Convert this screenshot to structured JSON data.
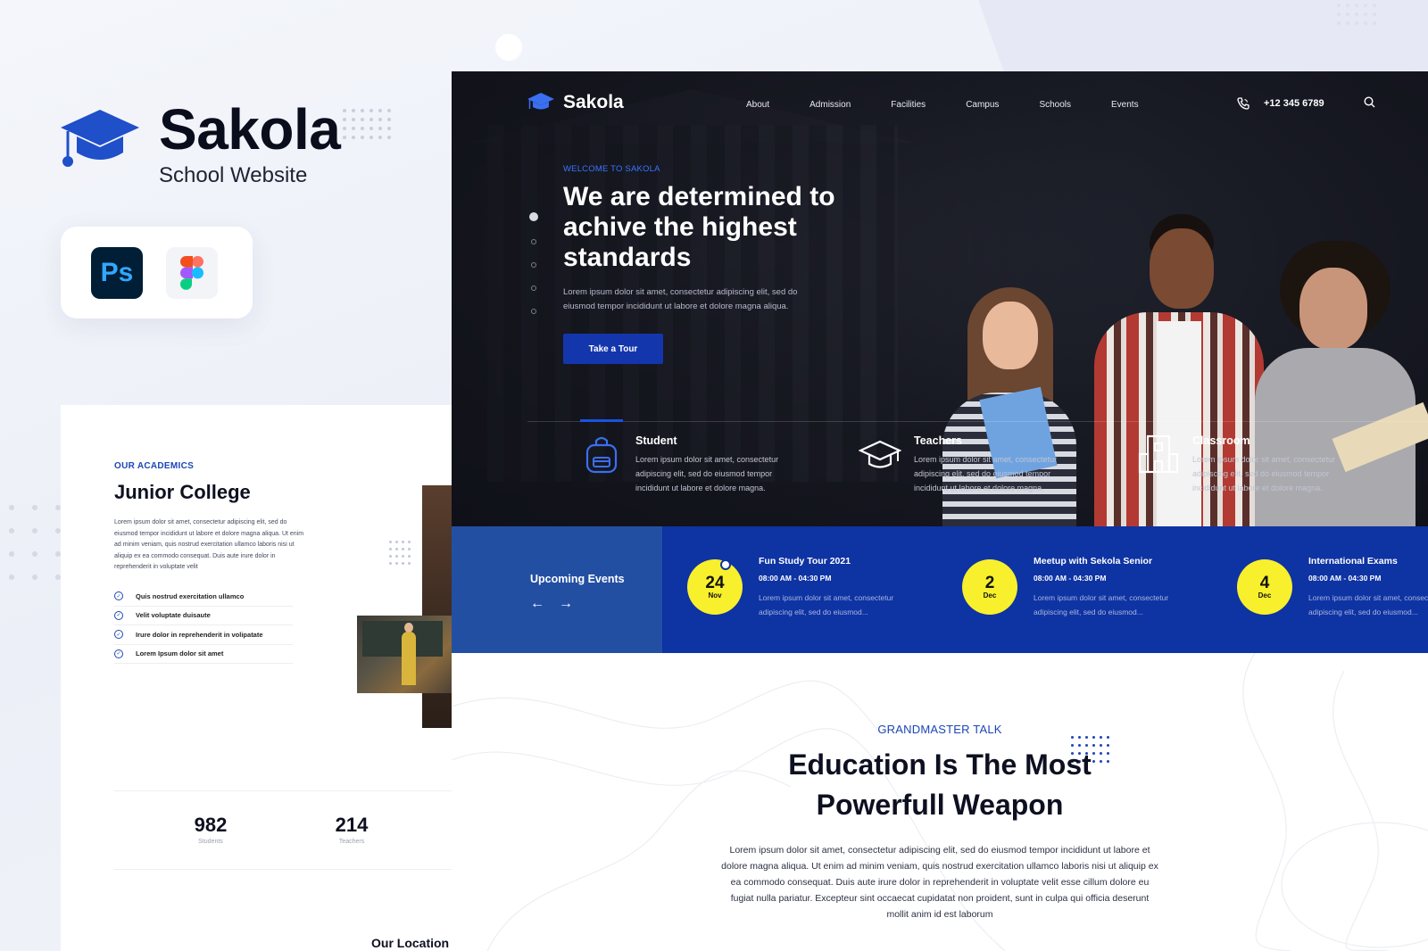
{
  "promo": {
    "brand_name": "Sakola",
    "brand_subtitle": "School Website",
    "tools": [
      "photoshop-icon",
      "figma-icon"
    ],
    "ps_label": "Ps"
  },
  "academics": {
    "eyebrow": "OUR ACADEMICS",
    "title": "Junior College",
    "body": "Lorem ipsum dolor sit amet, consectetur adipiscing elit, sed do eiusmod tempor incididunt ut labore et dolore magna aliqua. Ut enim ad minim veniam, quis nostrud exercitation ullamco laboris nisi ut aliquip ex ea commodo consequat. Duis aute irure dolor in reprehenderit in voluptate velit",
    "checklist": [
      "Quis nostrud exercitation ullamco",
      "Velit voluptate duisaute",
      "Irure dolor in reprehenderit in volipatate",
      "Lorem Ipsum dolor sit amet"
    ],
    "stats": [
      {
        "value": "982",
        "label": "Students"
      },
      {
        "value": "214",
        "label": "Teachers"
      }
    ],
    "location_heading": "Our Location"
  },
  "nav": {
    "logo_text": "Sakola",
    "menu": [
      "About",
      "Admission",
      "Facilities",
      "Campus",
      "Schools",
      "Events"
    ],
    "phone": "+12 345 6789"
  },
  "hero": {
    "eyebrow": "WELCOME TO SAKOLA",
    "title": "We are determined to achive the highest standards",
    "body": "Lorem ipsum dolor sit amet, consectetur adipiscing elit, sed do eiusmod tempor incididunt ut labore et dolore magna aliqua.",
    "cta": "Take a Tour"
  },
  "features": [
    {
      "icon": "backpack-icon",
      "title": "Student",
      "body": "Lorem ipsum dolor sit amet, consectetur adipiscing elit, sed do eiusmod tempor incididunt ut labore et dolore magna."
    },
    {
      "icon": "graduation-cap-icon",
      "title": "Teachers",
      "body": "Lorem ipsum dolor sit amet, consectetur adipiscing elit, sed do eiusmod tempor incididunt ut labore et dolore magna."
    },
    {
      "icon": "building-icon",
      "title": "Classroom",
      "body": "Lorem ipsum dolor sit amet, consectetur adipiscing elit, sed do eiusmod tempor incididunt ut labore et dolore magna."
    }
  ],
  "events": {
    "heading": "Upcoming Events",
    "prev_arrow": "←",
    "next_arrow": "→",
    "items": [
      {
        "day": "24",
        "month": "Nov",
        "title": "Fun Study Tour 2021",
        "time": "08:00 AM - 04:30 PM",
        "body": "Lorem ipsum dolor sit amet, consectetur adipiscing elit, sed do eiusmod..."
      },
      {
        "day": "2",
        "month": "Dec",
        "title": "Meetup with Sekola Senior",
        "time": "08:00 AM - 04:30 PM",
        "body": "Lorem ipsum dolor sit amet, consectetur adipiscing elit, sed do eiusmod..."
      },
      {
        "day": "4",
        "month": "Dec",
        "title": "International Exams",
        "time": "08:00 AM - 04:30 PM",
        "body": "Lorem ipsum dolor sit amet, consectetur adipiscing elit, sed do eiusmod..."
      }
    ]
  },
  "talk": {
    "eyebrow": "GRANDMASTER TALK",
    "title": "Education Is The Most Powerfull Weapon",
    "body": "Lorem ipsum dolor sit amet, consectetur adipiscing elit, sed do eiusmod tempor incididunt ut labore et dolore magna aliqua. Ut enim ad minim veniam, quis nostrud exercitation ullamco laboris nisi ut aliquip ex ea commodo consequat. Duis aute irure dolor in reprehenderit in voluptate velit esse cillum dolore eu fugiat nulla pariatur. Excepteur sint occaecat cupidatat non proident, sunt in culpa qui officia deserunt mollit anim id est laborum"
  },
  "colors": {
    "primary": "#1436ad",
    "events_bar": "#0e33a3",
    "events_side": "#234fa3",
    "date_badge": "#f8f02c",
    "hero_bg": "#15161f"
  }
}
